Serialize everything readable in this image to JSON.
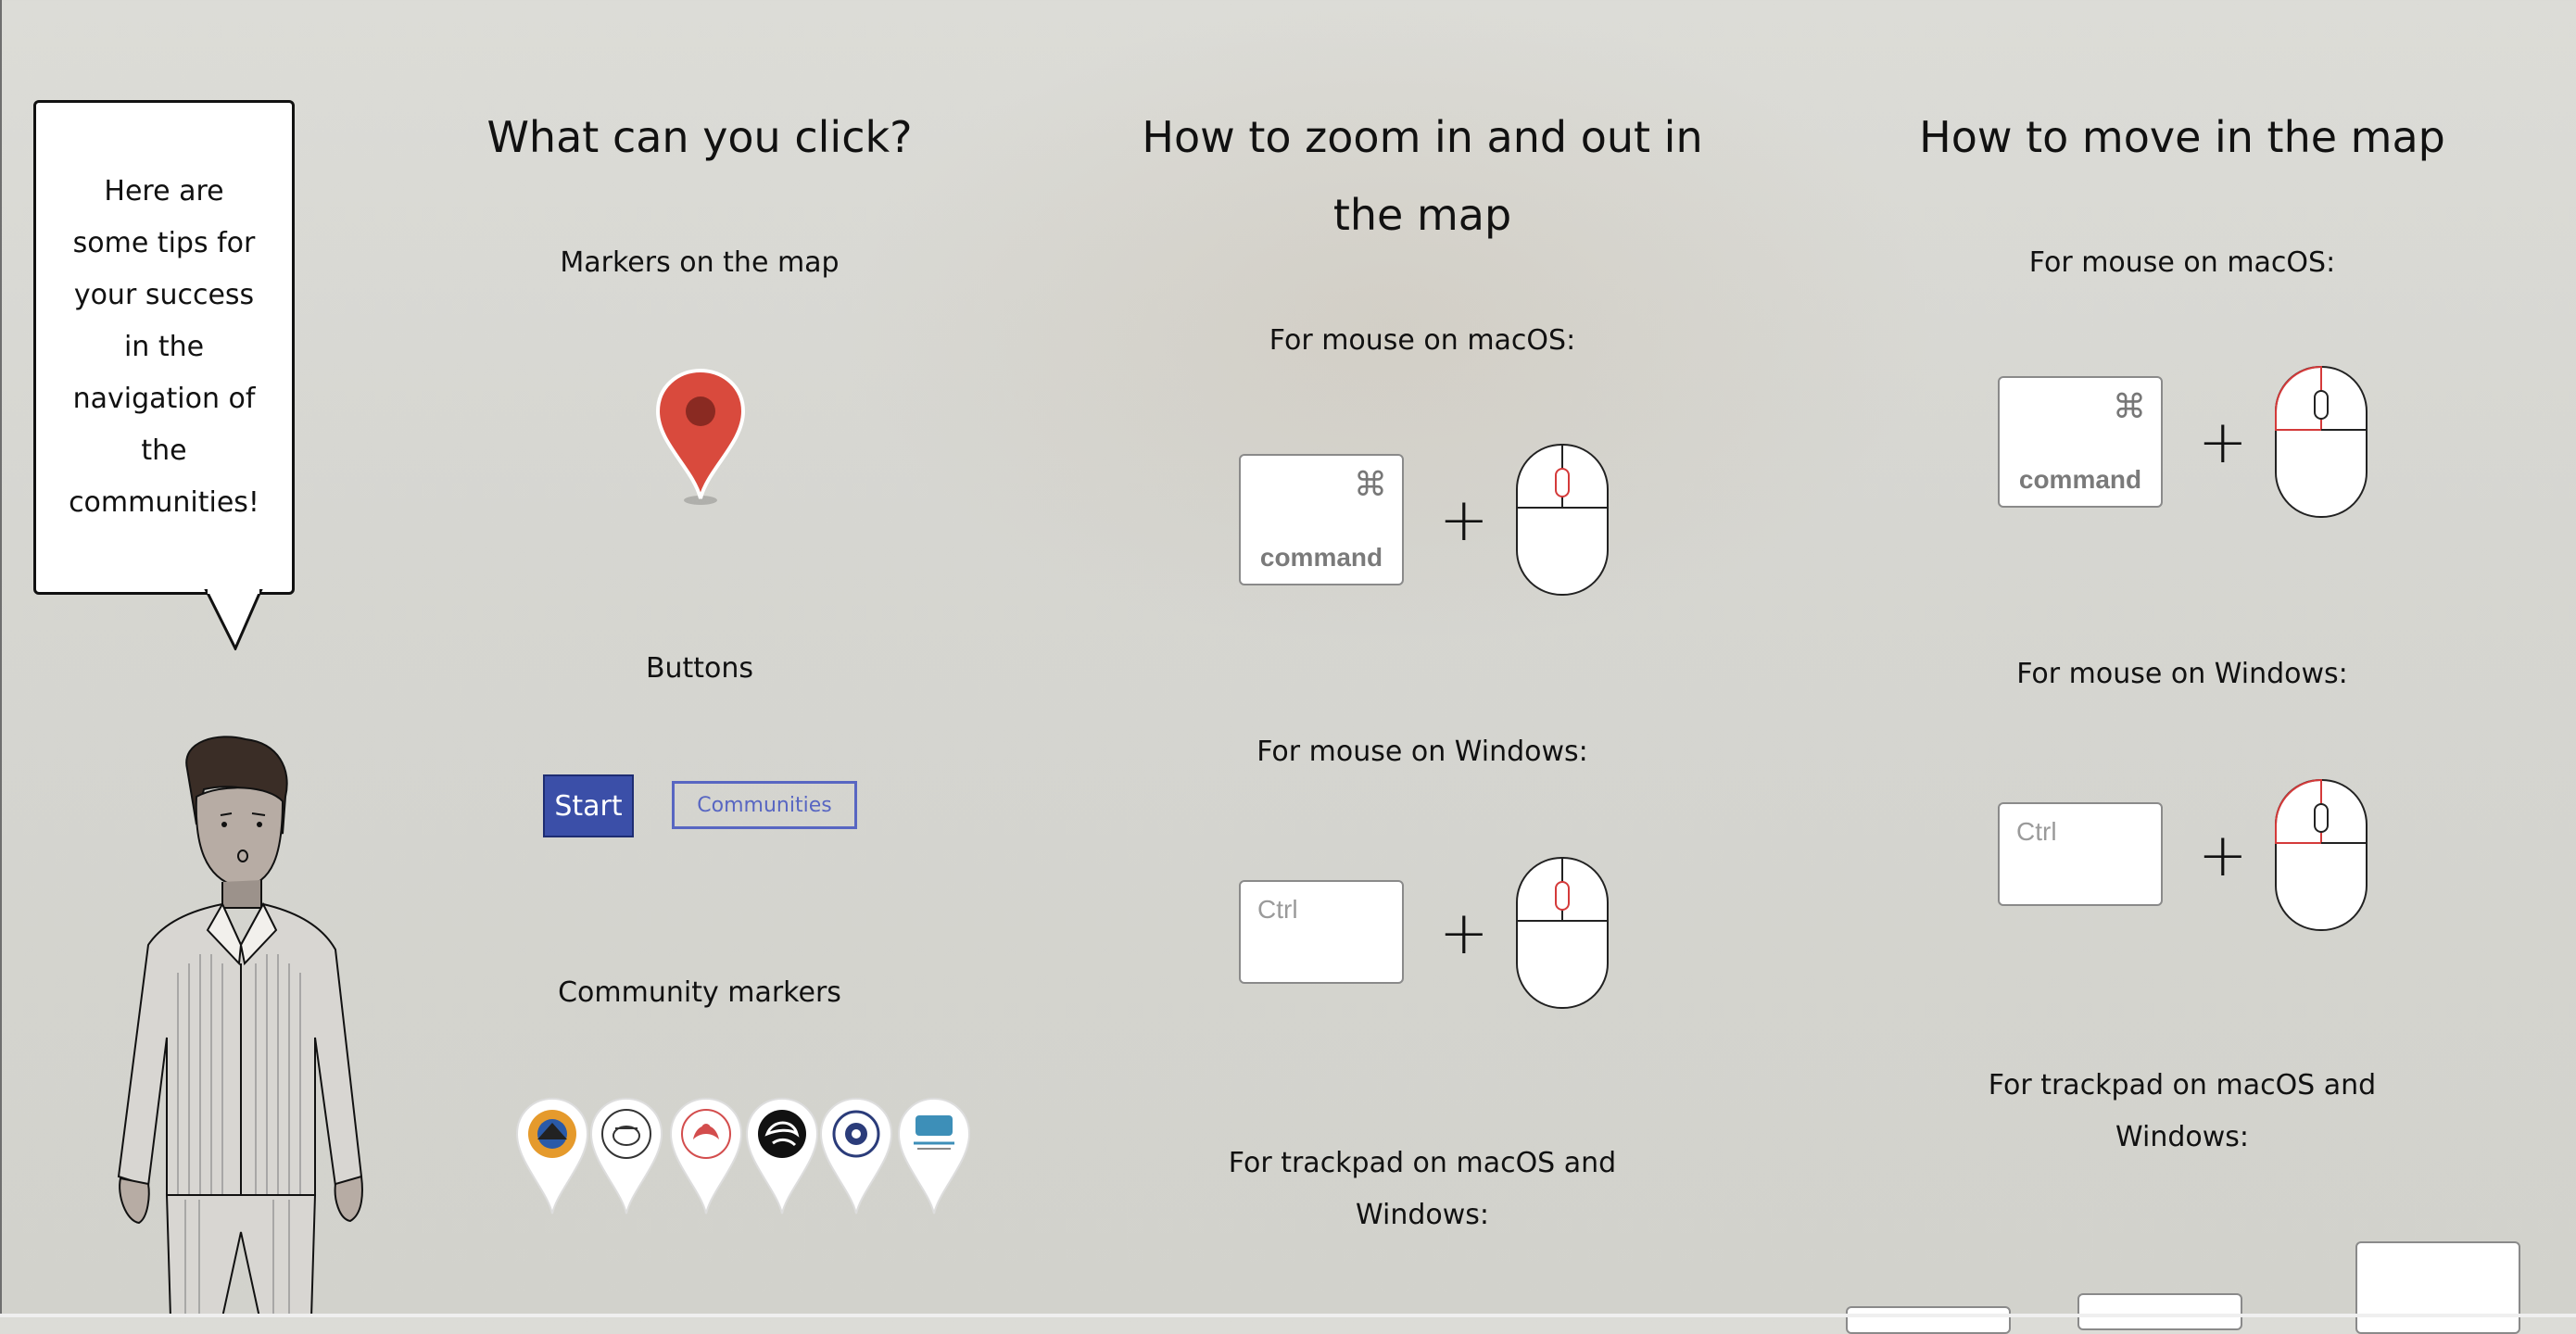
{
  "bubble": {
    "text": "Here are some tips for your success in the navigation of the communities!"
  },
  "click_section": {
    "title": "What can you click?",
    "markers_label": "Markers on the map",
    "buttons_label": "Buttons",
    "start_label": "Start",
    "communities_label": "Communities",
    "community_markers_label": "Community markers",
    "community_marker_icons": [
      "community-logo-1",
      "community-logo-2",
      "community-logo-3",
      "community-logo-4",
      "community-logo-5",
      "community-logo-6"
    ]
  },
  "zoom_section": {
    "title": "How to zoom in and out in the map",
    "mac_label": "For mouse on macOS:",
    "win_label": "For mouse on Windows:",
    "trackpad_label": "For trackpad on macOS and Windows:",
    "command_symbol": "⌘",
    "command_word": "command",
    "ctrl_word": "Ctrl",
    "plus": "+"
  },
  "move_section": {
    "title": "How to move in the map",
    "mac_label": "For mouse on macOS:",
    "win_label": "For mouse on Windows:",
    "trackpad_label": "For trackpad on macOS and Windows:",
    "command_symbol": "⌘",
    "command_word": "command",
    "ctrl_word": "Ctrl",
    "plus": "+"
  },
  "colors": {
    "marker_red": "#d94a3d",
    "start_blue": "#3b4fa8",
    "communities_blue": "#5866c2",
    "mouse_accent": "#d43a3a"
  }
}
